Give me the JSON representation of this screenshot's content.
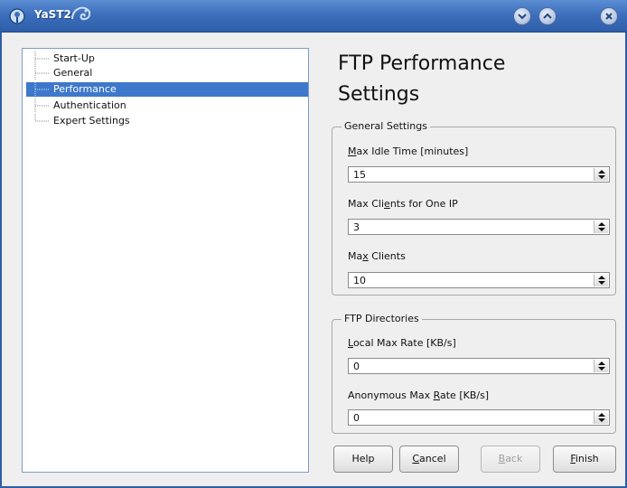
{
  "window": {
    "title": "YaST2",
    "icons": {
      "app": "yast-gear-icon",
      "extra": "chameleon-icon",
      "minimize": "chevron-down-icon",
      "maximize": "chevron-up-icon",
      "close": "close-icon"
    }
  },
  "tree": {
    "items": [
      {
        "label": "Start-Up",
        "selected": false
      },
      {
        "label": "General",
        "selected": false
      },
      {
        "label": "Performance",
        "selected": true
      },
      {
        "label": "Authentication",
        "selected": false
      },
      {
        "label": "Expert Settings",
        "selected": false
      }
    ]
  },
  "main": {
    "heading_line1": "FTP Performance",
    "heading_line2": "Settings",
    "general_settings": {
      "title": "General Settings",
      "fields": [
        {
          "label_pre": "",
          "label_key": "M",
          "label_post": "ax Idle Time [minutes]",
          "value": "15"
        },
        {
          "label_pre": "Max Cli",
          "label_key": "e",
          "label_post": "nts for One IP",
          "value": "3"
        },
        {
          "label_pre": "Ma",
          "label_key": "x",
          "label_post": " Clients",
          "value": "10"
        }
      ]
    },
    "ftp_directories": {
      "title": "FTP Directories",
      "fields": [
        {
          "label_pre": "",
          "label_key": "L",
          "label_post": "ocal Max Rate [KB/s]",
          "value": "0"
        },
        {
          "label_pre": "Anonymous Max ",
          "label_key": "R",
          "label_post": "ate [KB/s]",
          "value": "0"
        }
      ]
    }
  },
  "buttons": {
    "help": "Help",
    "cancel_key": "C",
    "cancel_rest": "ancel",
    "back_key": "B",
    "back_rest": "ack",
    "finish_key": "F",
    "finish_rest": "inish"
  },
  "colors": {
    "titlebar": "#3d6fbd",
    "selection": "#3e78cb",
    "tree_border": "#7f9bc8"
  }
}
